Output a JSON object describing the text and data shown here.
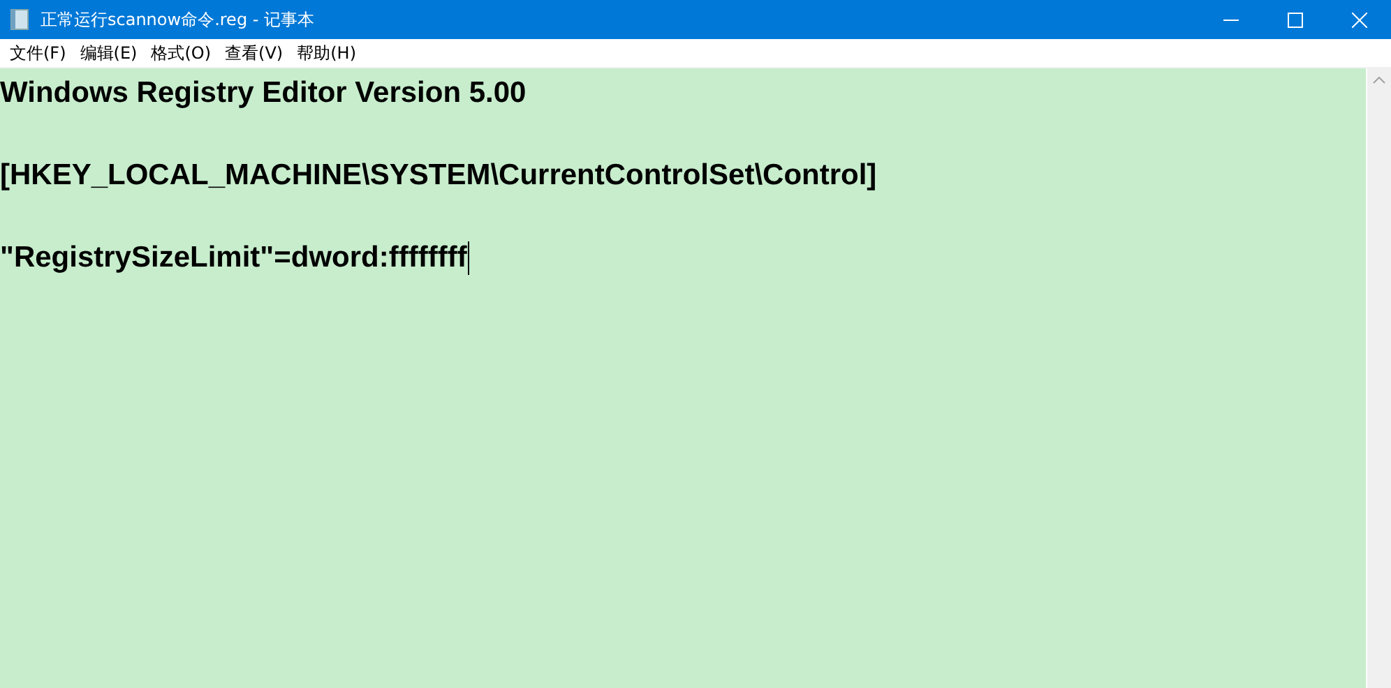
{
  "window": {
    "title": "正常运行scannow命令.reg - 记事本"
  },
  "menu": [
    "文件(F)",
    "编辑(E)",
    "格式(O)",
    "查看(V)",
    "帮助(H)"
  ],
  "editor": {
    "lines": [
      {
        "kind": "text",
        "text": "Windows Registry Editor Version 5.00"
      },
      {
        "kind": "blank"
      },
      {
        "kind": "text",
        "text": "[HKEY_LOCAL_MACHINE\\SYSTEM\\CurrentControlSet\\Control]"
      },
      {
        "kind": "blank"
      },
      {
        "kind": "text",
        "text": "\"RegistrySizeLimit\"=dword:ffffffff",
        "caret": true
      }
    ]
  }
}
